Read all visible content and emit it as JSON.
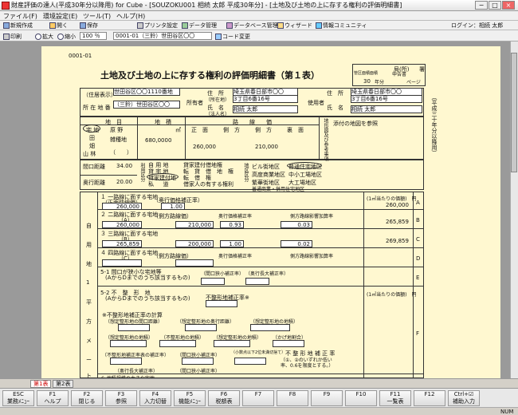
{
  "window": {
    "title": "財産評価の達人(平成30年分以降用) for Cube - [SOUZOKU001 相続 太郎 平成30年分] - [土地及び土地の上に存する権利の評価明細書]",
    "min": "−",
    "max": "□",
    "close": "×"
  },
  "menu": [
    "ファイル(F)",
    "環境設定(E)",
    "ツール(T)",
    "ヘルプ(H)"
  ],
  "toolbar": {
    "new": "新規作成",
    "open": "開く",
    "save": "保存",
    "print_setup": "プリンタ設定",
    "data_manage": "データ管理",
    "db_manage": "データベース管理",
    "wizard": "ウィザード",
    "community": "情報コミュニティ",
    "login": "ログイン：相続 太郎"
  },
  "toolbar2": {
    "print": "印刷",
    "zoom_in": "拡大",
    "zoom_out": "縮小",
    "zoom": "100 ％",
    "property": "0001-01（三鈴）世田谷区〇〇",
    "code_change": "コード変更"
  },
  "form": {
    "id": "0001-01",
    "title": "土地及び土地の上に存する権利の評価明細書（第１表）",
    "office_label": "局(所)",
    "office_suffix": "署",
    "year": "30",
    "year_suffix": "年分",
    "page_suffix": "ページ",
    "area_code": "管区面積面積",
    "check": "申告書",
    "side_note": "（平成三十年分以降用）",
    "address_label": "（住居表示）",
    "address_val": "世田谷区〇〇1110番地",
    "location_label": "所 在 地 番",
    "location_val": "（三鈴）世田谷区〇〇",
    "owner_label": "所有者",
    "addr2_label": "住　所",
    "addr2_sub": "（所在地）",
    "owner_addr": "埼玉県春日部市〇〇",
    "owner_addr2": "3丁目6番16号",
    "name_label": "氏　名",
    "name_sub": "（法人名）",
    "owner_name": "相続 太郎",
    "user_label": "使用者",
    "user_addr": "埼玉県春日部市〇〇",
    "user_addr2": "3丁目6番16号",
    "user_name": "相続 太郎",
    "chimoku": "地　目",
    "chiseki": "地　積",
    "rosenka": "路　　線　　価",
    "shomen": "正　面",
    "sokuho1": "側　方",
    "sokuho2": "側　方",
    "uramen": "裏　面",
    "chimoku_list": [
      "宅 地",
      "田",
      "畑",
      "山 林"
    ],
    "chimoku_list2": [
      "原 野",
      "雑種地",
      "（　　）"
    ],
    "area_val": "680,0000",
    "sqm": "㎡",
    "front_price": "260,000",
    "side_price": "210,000",
    "figure_label": "地形図及び参考事項",
    "figure_ref": "添付の地図を参照",
    "frontage_label": "間口距離",
    "frontage_val": "34.00",
    "depth_label": "奥行距離",
    "depth_val": "20.00",
    "m": "m",
    "use_label": "利用区分",
    "use_items": [
      "自 用 地",
      "貸 宅 地",
      "貸家建付地",
      "私 　 道"
    ],
    "use_items2": [
      "貸家建付借地権",
      "転　貸　借　地　権",
      "転　借　権",
      "借家人の有する権利"
    ],
    "district_label": "地区区分",
    "districts": [
      "ビル街地区",
      "高度商業地区",
      "繁華街地区",
      "普通商業・併用住宅地区"
    ],
    "districts2": [
      "普通住宅地区",
      "中小工場地区",
      "大工場地区"
    ],
    "col_price": "(1㎡当たりの価額)　円",
    "sec_self": "自",
    "sec_use": "用",
    "sec_land": "地",
    "sec_1": "1",
    "sec_hei": "平",
    "sec_ho": "方",
    "sec_me": "メ",
    "sec_to": "ー",
    "sec_ru": "ト",
    "row1_title": "１ 一路線に面する宅地",
    "row1_sub": "（正面路線価）",
    "row1_sub2": "（奥行価格補正率）",
    "row1_val": "260,000",
    "row1_rate": "1.00",
    "row1_total": "260,000",
    "row1_letter": "A",
    "row2_title": "２ 二路線に面する宅地",
    "row2_sub": "（A）",
    "row2_side": "（側方路線価）",
    "row2_rate_label": "奥行価格補正率",
    "row2_add": "側方路線影響加算率",
    "row2_val": "260,000",
    "row2_price": "210,000",
    "row2_rate": "0.93",
    "row2_add_val": "0.03",
    "row2_total": "265,859",
    "row2_letter": "B",
    "row3_title": "３ 三路線に面する宅地",
    "row3_sub": "（B）",
    "row3_val": "265,859",
    "row3_price": "200,000",
    "row3_rate": "1.00",
    "row3_add_val": "0.02",
    "row3_total": "269,859",
    "row3_letter": "C",
    "row4_title": "４ 四路線に面する宅地",
    "row4_sub": "（C）",
    "row4_side": "（側方路線価）",
    "row4_rate_label": "奥行価格補正率",
    "row4_add": "側方路線影響加算率",
    "row4_letter": "D",
    "row51_title": "5-1 間口が狭小な宅地等",
    "row51_sub": "(AからDまでのうち該当するもの)",
    "row51_a": "（間口狭小補正率）",
    "row51_b": "（奥行長大補正率）",
    "row51_letter": "E",
    "row52_title": "5-2 不　整　形　地",
    "row52_sub": "(AからDまでのうち該当するもの)",
    "row52_rate": "不整形地補正率※",
    "row52_letter": "F",
    "calc1": "※不整形地補正率の計算",
    "calc2": "（想定整形地の間口距離）",
    "calc3": "（想定整形地の奥行距離）",
    "calc4": "（想定整形地の地積）",
    "calc5": "（想定整形地の地積）",
    "calc6": "（不整形地の地積）",
    "calc7": "（想定整形地の地積）",
    "calc8": "（かげ地割合）",
    "calc9": "（不整形地補正率表の補正率）",
    "calc10": "（間口狭小補正率）",
    "calc11": "（小数点以下2位未満切捨て）",
    "calc12": "不 整 形 地 補 正 率",
    "calc13": "（①、②のいずれか低い",
    "calc14": "率、0.6を限度とする。）",
    "calc15": "（奥行長大補正率）",
    "calc16": "（間口狭小補正率）",
    "row6_title": "６ 地積規模の大きな宅地"
  },
  "tabs": [
    "第1表",
    "第2表"
  ],
  "fkeys": [
    {
      "k": "ESC",
      "l": "業務ﾒﾆｭｰ"
    },
    {
      "k": "F1",
      "l": "ヘルプ"
    },
    {
      "k": "F2",
      "l": "閉じる"
    },
    {
      "k": "F3",
      "l": "参照"
    },
    {
      "k": "F4",
      "l": "入力切替"
    },
    {
      "k": "F5",
      "l": "機能ﾒﾆｭｰ"
    },
    {
      "k": "F6",
      "l": "税額表"
    },
    {
      "k": "F7",
      "l": ""
    },
    {
      "k": "F8",
      "l": ""
    },
    {
      "k": "F9",
      "l": ""
    },
    {
      "k": "F10",
      "l": ""
    },
    {
      "k": "F11",
      "l": "一覧表"
    },
    {
      "k": "F12",
      "l": ""
    },
    {
      "k": "Ctrl+☑",
      "l": "補助入力"
    }
  ],
  "status": {
    "num": "NUM"
  }
}
